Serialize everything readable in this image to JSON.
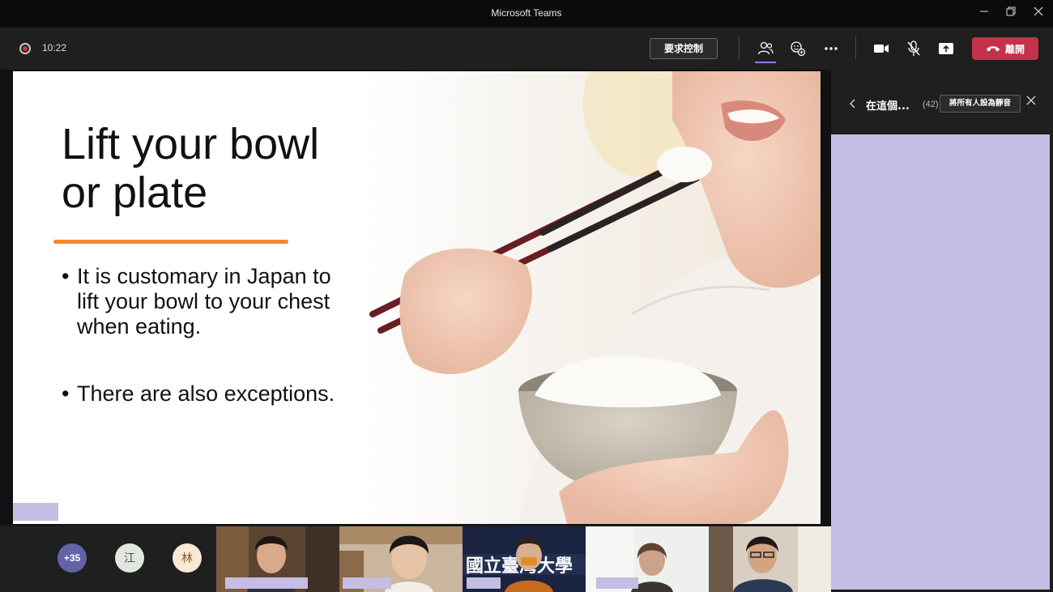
{
  "window": {
    "title": "Microsoft Teams"
  },
  "toolbar": {
    "timer": "10:22",
    "request_control": "要求控制",
    "leave": "離開"
  },
  "slide": {
    "title_line1": "Lift your bowl",
    "title_line2": "or plate",
    "bullets": [
      "It is customary in Japan to lift your bowl to your chest when eating.",
      "There are also exceptions."
    ],
    "accent_color": "#f08a2c"
  },
  "strip": {
    "overflow_count": "+35",
    "avatars": [
      "江",
      "林"
    ]
  },
  "panel": {
    "title": "在這個...",
    "count": "(42)",
    "mute_all": "將所有人設為靜音"
  },
  "colors": {
    "leave": "#c4314b",
    "brand": "#6264a7",
    "redaction": "#c5bde4"
  },
  "icons": {
    "record": "record-icon",
    "participants": "people-icon",
    "reactions": "reaction-icon",
    "more": "more-icon",
    "camera": "camera-icon",
    "mic_off": "mic-off-icon",
    "share": "share-tray-icon",
    "hangup": "phone-icon"
  }
}
